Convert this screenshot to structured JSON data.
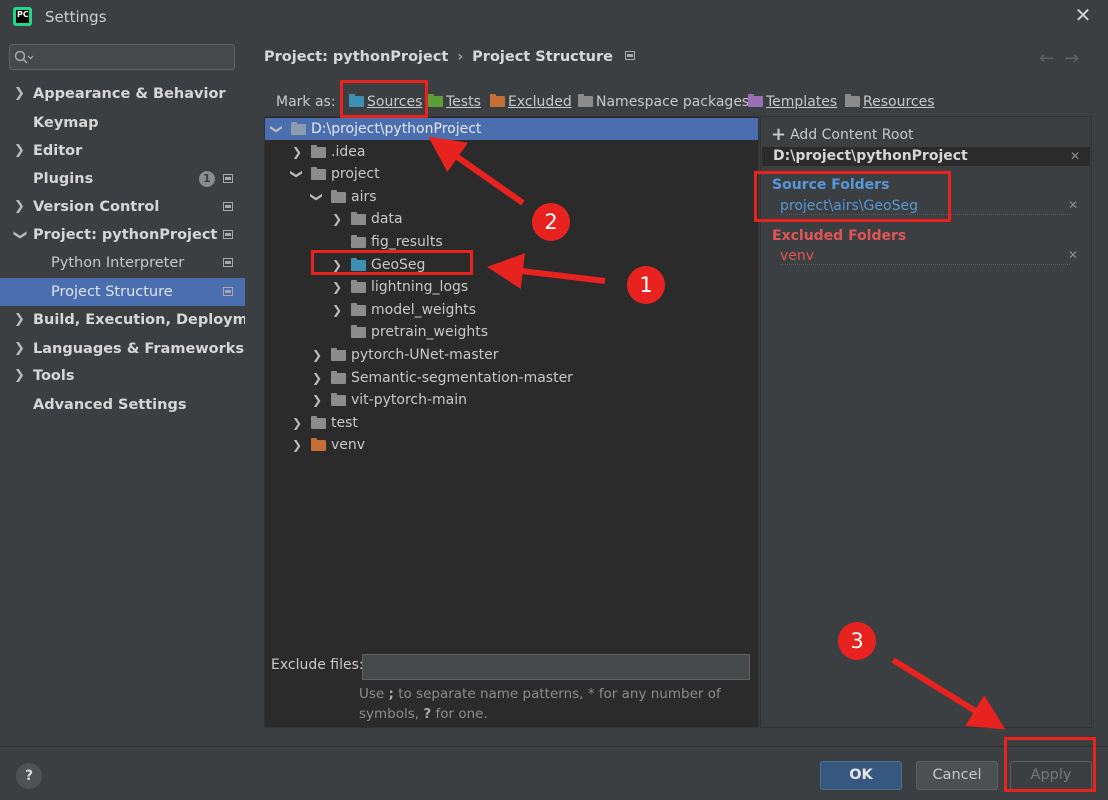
{
  "window": {
    "title": "Settings",
    "app_icon": "pycharm-icon"
  },
  "search": {
    "placeholder": ""
  },
  "sidebar": {
    "items": [
      {
        "label": "Appearance & Behavior",
        "expandable": true
      },
      {
        "label": "Keymap",
        "expandable": false
      },
      {
        "label": "Editor",
        "expandable": true
      },
      {
        "label": "Plugins",
        "expandable": false,
        "badge": "1"
      },
      {
        "label": "Version Control",
        "expandable": true
      },
      {
        "label": "Project: pythonProject",
        "expandable": true,
        "expanded": true
      },
      {
        "label": "Python Interpreter",
        "sub": true
      },
      {
        "label": "Project Structure",
        "sub": true,
        "selected": true
      },
      {
        "label": "Build, Execution, Deployment",
        "expandable": true
      },
      {
        "label": "Languages & Frameworks",
        "expandable": true
      },
      {
        "label": "Tools",
        "expandable": true
      },
      {
        "label": "Advanced Settings",
        "expandable": false
      }
    ]
  },
  "breadcrumb": {
    "parent": "Project: pythonProject",
    "separator": "›",
    "current": "Project Structure"
  },
  "mark_as": {
    "label": "Mark as:",
    "buttons": [
      {
        "label": "Sources",
        "color": "#3d8fb3"
      },
      {
        "label": "Tests",
        "color": "#5c9e3a"
      },
      {
        "label": "Excluded",
        "color": "#c46f36"
      },
      {
        "label": "Namespace packages",
        "color": "#8c8c8c"
      },
      {
        "label": "Templates",
        "color": "#9b6fb3"
      },
      {
        "label": "Resources",
        "color": "#8c8c8c"
      }
    ]
  },
  "tree": [
    {
      "name": "D:\\project\\pythonProject",
      "level": 0,
      "expanded": true,
      "selected": true,
      "folder_color": "#8c9cb0"
    },
    {
      "name": ".idea",
      "level": 1,
      "has_children": true,
      "folder_color": "#8c8c8c"
    },
    {
      "name": "project",
      "level": 1,
      "expanded": true,
      "folder_color": "#8c8c8c"
    },
    {
      "name": "airs",
      "level": 2,
      "expanded": true,
      "folder_color": "#8c8c8c"
    },
    {
      "name": "data",
      "level": 3,
      "has_children": true,
      "folder_color": "#8c8c8c"
    },
    {
      "name": "fig_results",
      "level": 3,
      "has_children": false,
      "folder_color": "#8c8c8c"
    },
    {
      "name": "GeoSeg",
      "level": 3,
      "has_children": true,
      "folder_color": "#3d8fb3"
    },
    {
      "name": "lightning_logs",
      "level": 3,
      "has_children": true,
      "folder_color": "#8c8c8c"
    },
    {
      "name": "model_weights",
      "level": 3,
      "has_children": true,
      "folder_color": "#8c8c8c"
    },
    {
      "name": "pretrain_weights",
      "level": 3,
      "has_children": false,
      "folder_color": "#8c8c8c"
    },
    {
      "name": "pytorch-UNet-master",
      "level": 2,
      "has_children": true,
      "folder_color": "#8c8c8c"
    },
    {
      "name": "Semantic-segmentation-master",
      "level": 2,
      "has_children": true,
      "folder_color": "#8c8c8c"
    },
    {
      "name": "vit-pytorch-main",
      "level": 2,
      "has_children": true,
      "folder_color": "#8c8c8c"
    },
    {
      "name": "test",
      "level": 1,
      "has_children": true,
      "folder_color": "#8c8c8c"
    },
    {
      "name": "venv",
      "level": 1,
      "has_children": true,
      "folder_color": "#c46f36"
    }
  ],
  "exclude": {
    "label": "Exclude files:",
    "value": "",
    "hint_pre": "Use ",
    "hint_sep": ";",
    "hint_mid": " to separate name patterns, * for any number of symbols, ",
    "hint_q": "?",
    "hint_post": " for one."
  },
  "content_roots": {
    "add_label": "Add Content Root",
    "root_path": "D:\\project\\pythonProject",
    "source_title": "Source Folders",
    "source_item": "project\\airs\\GeoSeg",
    "excluded_title": "Excluded Folders",
    "excluded_item": "venv",
    "source_color": "#5897d8",
    "excluded_color": "#e05555"
  },
  "footer": {
    "help": "?",
    "ok": "OK",
    "cancel": "Cancel",
    "apply": "Apply"
  },
  "annotations": {
    "one": "1",
    "two": "2",
    "three": "3",
    "color": "#e8231f"
  }
}
